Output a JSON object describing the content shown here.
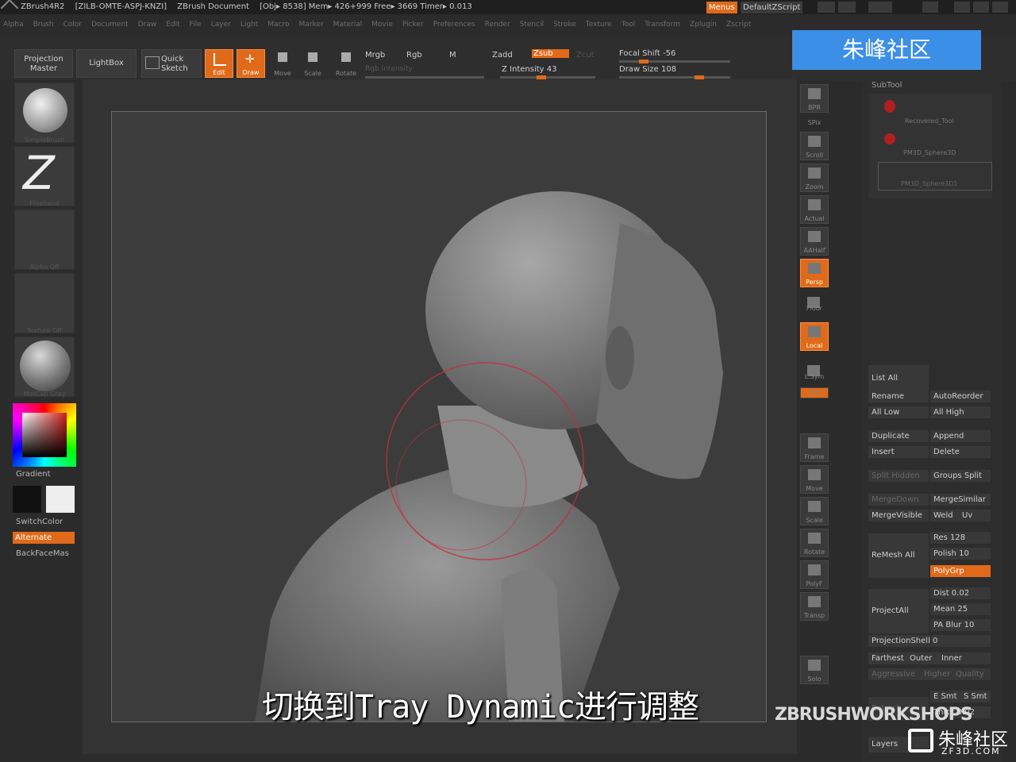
{
  "titlebar": {
    "app": "ZBrush4R2",
    "serial": "[ZILB-OMTE-ASPJ-KNZI]",
    "doc": "ZBrush Document",
    "stats": "[Obj▸ 8538] Mem▸ 426+999  Free▸ 3669  Timer▸ 0.013",
    "menus_btn": "Menus",
    "script_btn": "DefaultZScript"
  },
  "menubar": [
    "Alpha",
    "Brush",
    "Color",
    "Document",
    "Draw",
    "Edit",
    "File",
    "Layer",
    "Light",
    "Macro",
    "Marker",
    "Material",
    "Movie",
    "Picker",
    "Preferences",
    "Render",
    "Stencil",
    "Stroke",
    "Texture",
    "Tool",
    "Transform",
    "Zplugin",
    "Zscript"
  ],
  "toolbar": {
    "projection_master": "Projection Master",
    "lightbox": "LightBox",
    "quick_sketch": "Quick Sketch",
    "edit": "Edit",
    "draw": "Draw",
    "move": "Move",
    "scale": "Scale",
    "rotate": "Rotate",
    "mrgb": "Mrgb",
    "rgb": "Rgb",
    "m": "M",
    "rgb_intensity": "Rgb Intensity",
    "zadd": "Zadd",
    "zsub": "Zsub",
    "zcut": "Zcut",
    "z_intensity": "Z Intensity 43",
    "z_intensity_value": 43,
    "focal_shift": "Focal Shift -56",
    "focal_shift_value": -56,
    "draw_size": "Draw Size 108",
    "draw_size_value": 108
  },
  "left": {
    "slots": [
      "SimpleBrush",
      "Freehand",
      "Alpha Off",
      "Texture Off",
      "MatCap Gray"
    ],
    "gradient": "Gradient",
    "switchcolor": "SwitchColor",
    "alternate": "Alternate",
    "backfacemask": "BackFaceMas"
  },
  "shelf": [
    "BPR",
    "SPix",
    "Scroll",
    "Zoom",
    "Actual",
    "AAHalf",
    "Persp",
    "Floor",
    "Local",
    "L.Sym",
    "XYZ",
    "",
    "",
    "Frame",
    "Move",
    "Scale",
    "Rotate",
    "PolyF",
    "Transp",
    "",
    "Solo",
    ""
  ],
  "tray": {
    "title": "SubTool",
    "subtools": [
      "Recovered_Tool",
      "PM3D_Sphere3D",
      "PM3D_Sphere3D1"
    ],
    "list_all": "List  All",
    "rename": "Rename",
    "autoreorder": "AutoReorder",
    "all_low": "All Low",
    "all_high": "All High",
    "duplicate": "Duplicate",
    "append": "Append",
    "insert": "Insert",
    "delete": "Delete",
    "split_hidden": "Split Hidden",
    "groups_split": "Groups Split",
    "merge_down": "MergeDown",
    "merge_similar": "MergeSimilar",
    "merge_visible": "MergeVisible",
    "weld": "Weld",
    "uv": "Uv",
    "remesh_all": "ReMesh  All",
    "res": "Res 128",
    "polish": "Polish 10",
    "polygrp": "PolyGrp",
    "project_all": "ProjectAll",
    "dist": "Dist 0.02",
    "mean": "Mean 25",
    "pa_blur": "PA Blur 10",
    "projection_shell": "ProjectionShell 0",
    "farthest": "Farthest",
    "outer": "Outer",
    "inner": "Inner",
    "aggressive": "Aggressive",
    "higher": "Higher",
    "quality": "Quality",
    "e_smt": "E Smt",
    "s_smt": "S Smt",
    "extract": "Extract",
    "thick": "Thick 0.02",
    "layers": "Layers"
  },
  "subtitle": "切换到Tray Dynamic进行调整",
  "watermark": {
    "top": "朱峰社区",
    "workshop": "ZBRUSHWORKSHOPS",
    "corner": "朱峰社区",
    "corner_url": "ZF3D.COM"
  },
  "colors": {
    "accent": "#e06a1a",
    "bg": "#2b2b2b",
    "canvas": "#3c3c3c"
  }
}
